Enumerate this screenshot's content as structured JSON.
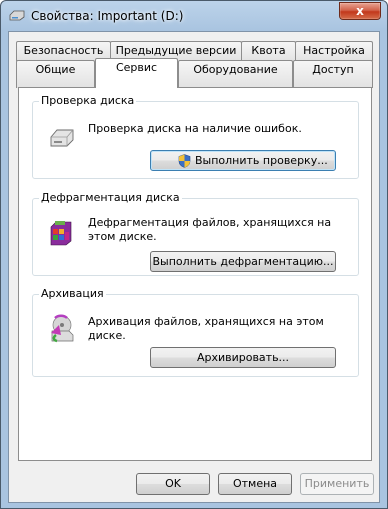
{
  "window": {
    "title": "Свойства: Important (D:)",
    "close_label": "x"
  },
  "tabs_row1": [
    {
      "label": "Безопасность"
    },
    {
      "label": "Предыдущие версии"
    },
    {
      "label": "Квота"
    },
    {
      "label": "Настройка"
    }
  ],
  "tabs_row2": [
    {
      "label": "Общие"
    },
    {
      "label": "Сервис",
      "selected": true
    },
    {
      "label": "Оборудование"
    },
    {
      "label": "Доступ"
    }
  ],
  "groups": {
    "check": {
      "title": "Проверка диска",
      "description": "Проверка диска на наличие ошибок.",
      "button_label": "Выполнить проверку..."
    },
    "defrag": {
      "title": "Дефрагментация диска",
      "description": "Дефрагментация файлов, хранящихся на этом диске.",
      "button_label": "Выполнить дефрагментацию..."
    },
    "backup": {
      "title": "Архивация",
      "description": "Архивация файлов, хранящихся на этом диске.",
      "button_label": "Архивировать..."
    }
  },
  "footer": {
    "ok_label": "OK",
    "cancel_label": "Отмена",
    "apply_label": "Применить",
    "apply_enabled": false
  }
}
